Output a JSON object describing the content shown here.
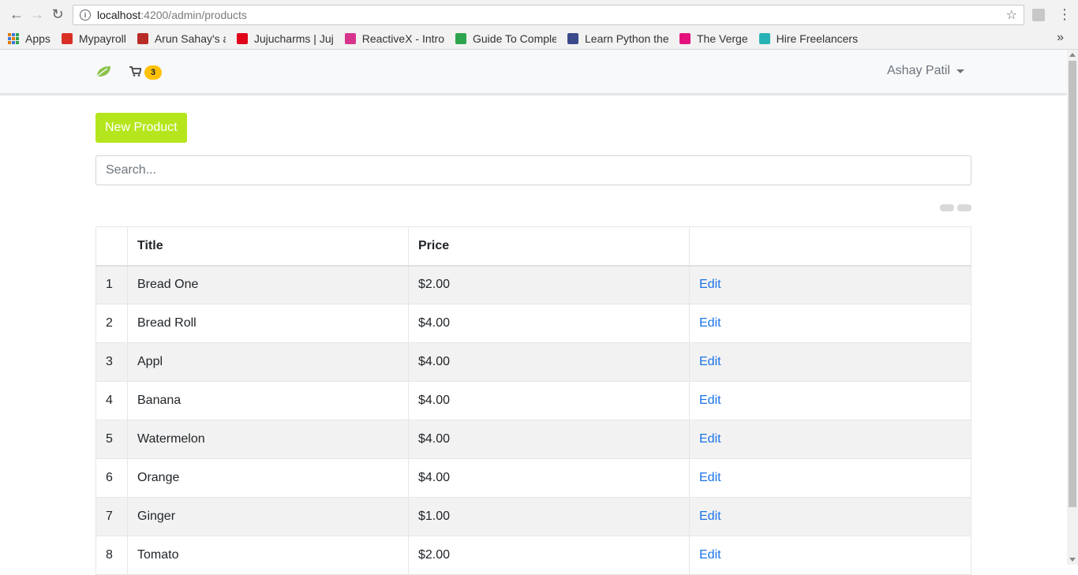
{
  "browser": {
    "url_host": "localhost",
    "url_path": ":4200/admin/products",
    "bookmarks": [
      {
        "label": "Apps",
        "icon": "apps-grid-icon",
        "color": "#e07b00"
      },
      {
        "label": "Mypayroll",
        "icon": "mypayroll-icon",
        "color": "#d93025"
      },
      {
        "label": "Arun Sahay's ans",
        "icon": "quora-icon",
        "color": "#b92b27"
      },
      {
        "label": "Jujucharms | Juj",
        "icon": "jujucharms-icon",
        "color": "#e0041a"
      },
      {
        "label": "ReactiveX - Intro",
        "icon": "reactivex-icon",
        "color": "#d6338c"
      },
      {
        "label": "Guide To Comple",
        "icon": "guide-icon",
        "color": "#2da44e"
      },
      {
        "label": "Learn Python the",
        "icon": "python-book-icon",
        "color": "#3b4a8a"
      },
      {
        "label": "The Verge",
        "icon": "verge-icon",
        "color": "#e5127d"
      },
      {
        "label": "Hire Freelancers",
        "icon": "freelancer-icon",
        "color": "#29b2b5"
      }
    ]
  },
  "navbar": {
    "cart_count": "3",
    "user_name": "Ashay Patil",
    "brand_color": "#8bc34a"
  },
  "main": {
    "new_product_label": "New Product",
    "search_placeholder": "Search...",
    "table": {
      "headers": [
        "",
        "Title",
        "Price",
        ""
      ],
      "rows": [
        {
          "index": "1",
          "title": "Bread One",
          "price": "$2.00",
          "action": "Edit"
        },
        {
          "index": "2",
          "title": "Bread Roll",
          "price": "$4.00",
          "action": "Edit"
        },
        {
          "index": "3",
          "title": "Appl",
          "price": "$4.00",
          "action": "Edit"
        },
        {
          "index": "4",
          "title": "Banana",
          "price": "$4.00",
          "action": "Edit"
        },
        {
          "index": "5",
          "title": "Watermelon",
          "price": "$4.00",
          "action": "Edit"
        },
        {
          "index": "6",
          "title": "Orange",
          "price": "$4.00",
          "action": "Edit"
        },
        {
          "index": "7",
          "title": "Ginger",
          "price": "$1.00",
          "action": "Edit"
        },
        {
          "index": "8",
          "title": "Tomato",
          "price": "$2.00",
          "action": "Edit"
        }
      ]
    }
  }
}
